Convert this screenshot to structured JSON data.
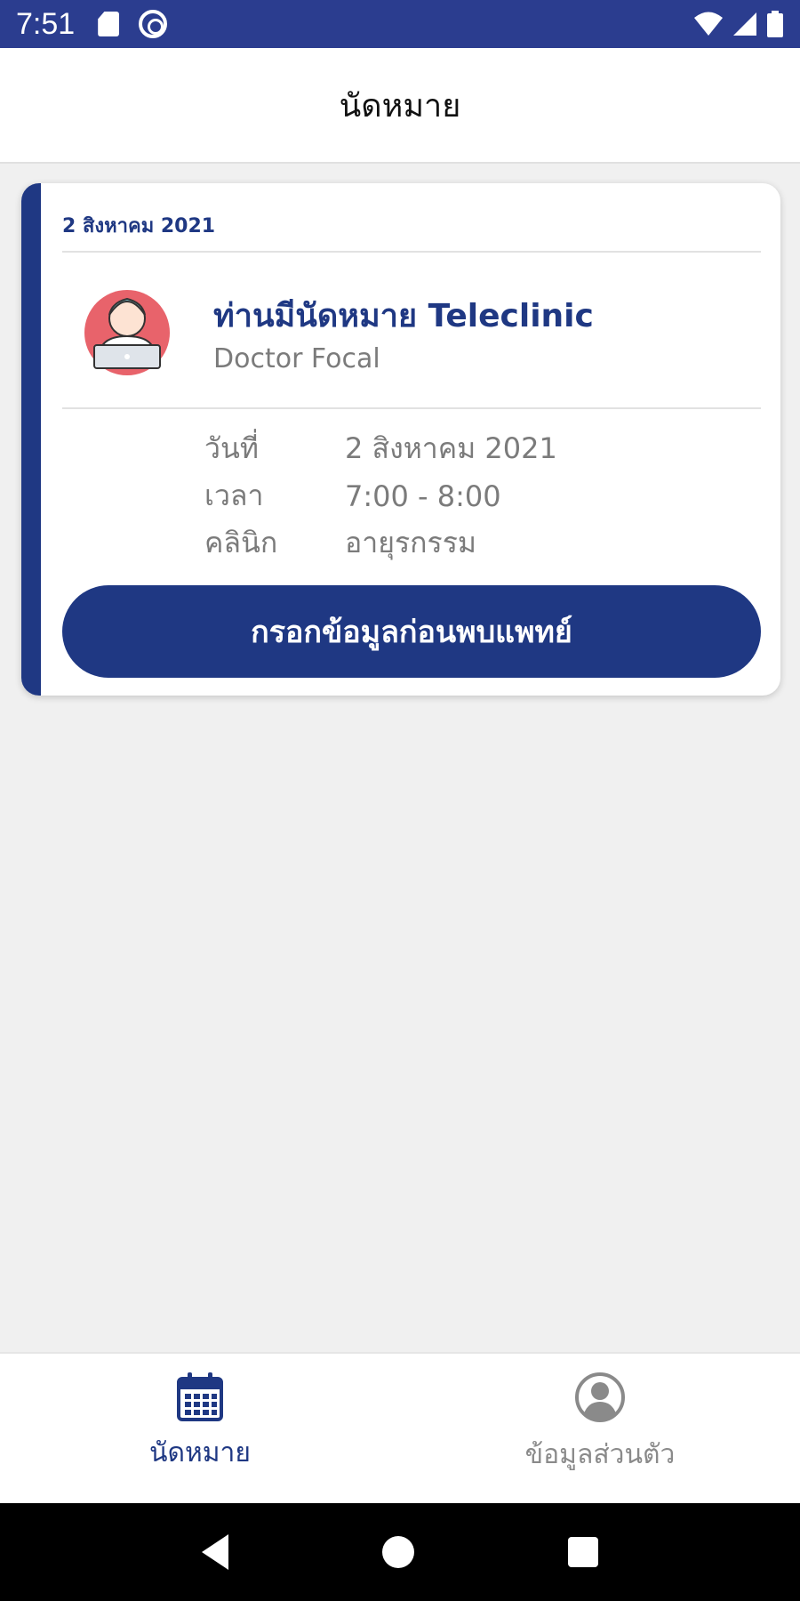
{
  "status_bar": {
    "time": "7:51",
    "icons": [
      "sd-card-icon",
      "sync-icon",
      "wifi-icon",
      "signal-icon",
      "battery-icon"
    ]
  },
  "header": {
    "title": "นัดหมาย"
  },
  "appointment_card": {
    "date": "2 สิงหาคม 2021",
    "title": "ท่านมีนัดหมาย Teleclinic",
    "doctor": "Doctor Focal",
    "avatar": "doctor-avatar-icon",
    "details": [
      {
        "label": "วันที่",
        "value": "2 สิงหาคม 2021"
      },
      {
        "label": "เวลา",
        "value": "7:00 - 8:00"
      },
      {
        "label": "คลินิก",
        "value": "อายุรกรรม"
      }
    ],
    "button_label": "กรอกข้อมูลก่อนพบแพทย์"
  },
  "bottom_nav": {
    "items": [
      {
        "label": "นัดหมาย",
        "icon": "calendar-icon",
        "active": true
      },
      {
        "label": "ข้อมูลส่วนตัว",
        "icon": "profile-icon",
        "active": false
      }
    ]
  },
  "colors": {
    "primary": "#1f3883",
    "status_bar": "#2b3d8f",
    "background": "#f0f0f0",
    "muted_text": "#7b7b7b"
  }
}
